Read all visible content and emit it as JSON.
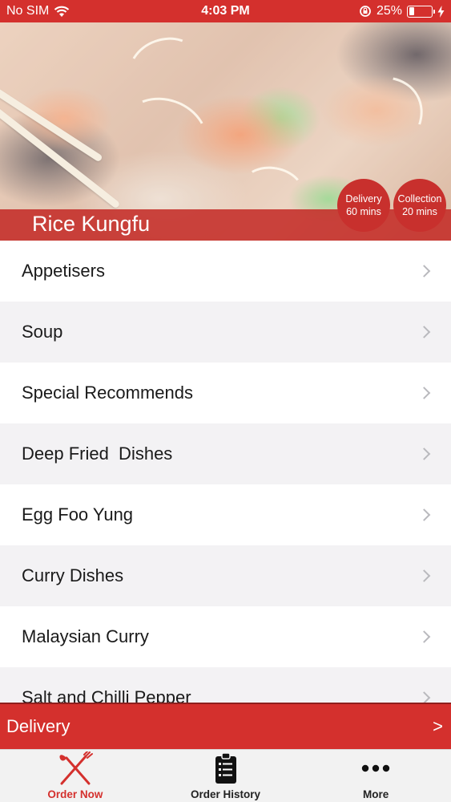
{
  "status_bar": {
    "carrier": "No SIM",
    "time": "4:03 PM",
    "battery": "25%",
    "battery_level": 0.25
  },
  "restaurant": {
    "name": "Rice Kungfu"
  },
  "badges": {
    "delivery": {
      "label": "Delivery",
      "time": "60 mins"
    },
    "collection": {
      "label": "Collection",
      "time": "20 mins"
    }
  },
  "menu": {
    "items": [
      {
        "label": "Appetisers"
      },
      {
        "label": "Soup"
      },
      {
        "label": "Special Recommends"
      },
      {
        "label": "Deep Fried  Dishes"
      },
      {
        "label": "Egg Foo Yung"
      },
      {
        "label": "Curry Dishes"
      },
      {
        "label": "Malaysian Curry"
      },
      {
        "label": "Salt and Chilli Pepper"
      }
    ]
  },
  "delivery_bar": {
    "label": "Delivery",
    "arrow": ">"
  },
  "tabs": [
    {
      "label": "Order Now",
      "icon": "fork-knife-icon",
      "active": true
    },
    {
      "label": "Order History",
      "icon": "clipboard-list-icon",
      "active": false
    },
    {
      "label": "More",
      "icon": "more-dots-icon",
      "active": false
    }
  ],
  "colors": {
    "brand_red": "#d4302d",
    "tab_active": "#d4302d",
    "row_alt": "#f3f2f4"
  }
}
